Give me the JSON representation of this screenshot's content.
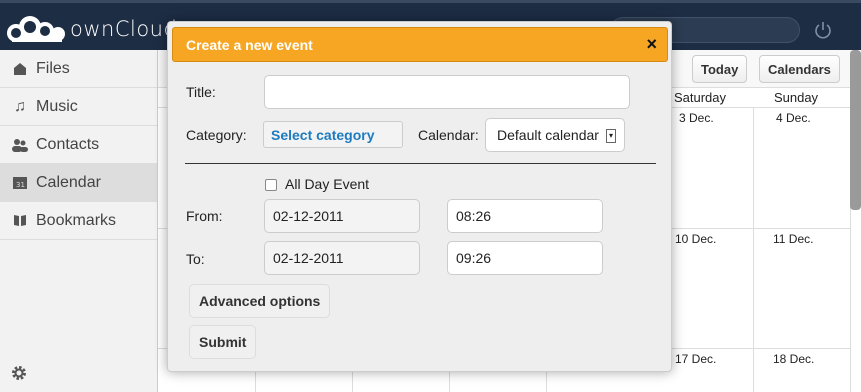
{
  "header": {
    "app_name": "ownCloud"
  },
  "sidebar": {
    "items": [
      {
        "label": "Files",
        "icon": "folder-icon"
      },
      {
        "label": "Music",
        "icon": "music-note-icon"
      },
      {
        "label": "Contacts",
        "icon": "people-icon"
      },
      {
        "label": "Calendar",
        "icon": "calendar-icon",
        "active": true
      },
      {
        "label": "Bookmarks",
        "icon": "book-icon"
      }
    ]
  },
  "calendar": {
    "toolbar": {
      "today_label": "Today",
      "calendars_label": "Calendars"
    },
    "day_headers": [
      "Saturday",
      "Sunday"
    ],
    "dates": [
      "3 Dec.",
      "4 Dec.",
      "10 Dec.",
      "11 Dec.",
      "17 Dec.",
      "18 Dec."
    ]
  },
  "modal": {
    "title": "Create a new event",
    "close_label": "×",
    "title_label": "Title:",
    "title_value": "",
    "category_label": "Category:",
    "category_value": "Select category",
    "calendar_label": "Calendar:",
    "calendar_value": "Default calendar",
    "all_day_label": "All Day Event",
    "from_label": "From:",
    "from_date": "02-12-2011",
    "from_time": "08:26",
    "to_label": "To:",
    "to_date": "02-12-2011",
    "to_time": "09:26",
    "advanced_label": "Advanced options",
    "submit_label": "Submit"
  },
  "colors": {
    "header_bg": "#1d2d44",
    "modal_header": "#f6a623",
    "category_link": "#1d7bbf"
  }
}
